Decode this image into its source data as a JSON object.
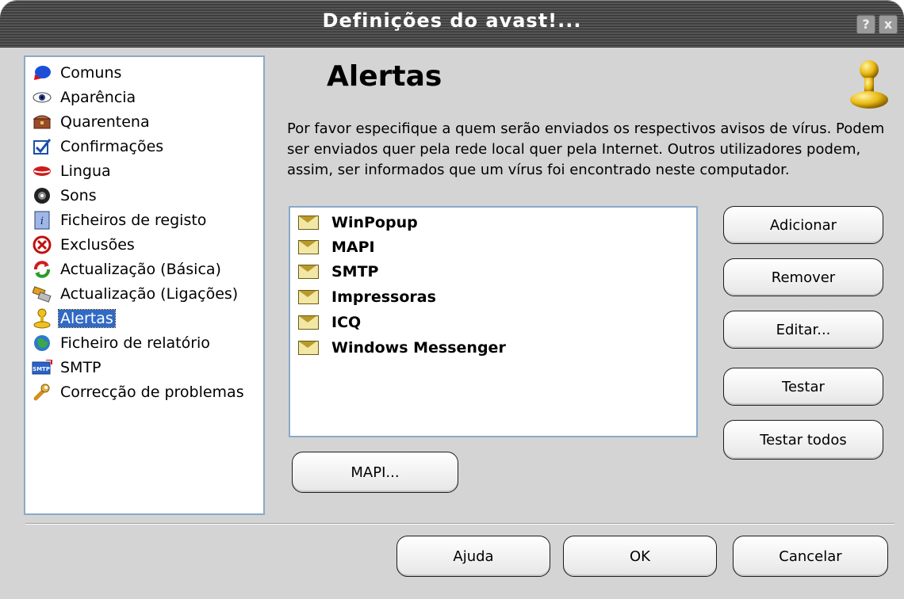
{
  "window": {
    "title": "Definições do avast!...",
    "help_btn": "?",
    "close_btn": "x"
  },
  "sidebar": {
    "items": [
      {
        "label": "Comuns",
        "icon": "cap-icon"
      },
      {
        "label": "Aparência",
        "icon": "eye-icon"
      },
      {
        "label": "Quarentena",
        "icon": "chest-icon"
      },
      {
        "label": "Confirmações",
        "icon": "checkbox-icon"
      },
      {
        "label": "Lingua",
        "icon": "lips-icon"
      },
      {
        "label": "Sons",
        "icon": "speaker-icon"
      },
      {
        "label": "Ficheiros de registo",
        "icon": "info-icon"
      },
      {
        "label": "Exclusões",
        "icon": "cross-circle-icon"
      },
      {
        "label": "Actualização (Básica)",
        "icon": "update-icon"
      },
      {
        "label": "Actualização (Ligações)",
        "icon": "connection-icon"
      },
      {
        "label": "Alertas",
        "icon": "alert-figure-icon",
        "selected": true
      },
      {
        "label": "Ficheiro de relatório",
        "icon": "report-icon"
      },
      {
        "label": "SMTP",
        "icon": "smtp-icon"
      },
      {
        "label": "Correcção de problemas",
        "icon": "wrench-icon"
      }
    ]
  },
  "main": {
    "heading": "Alertas",
    "description": "Por favor especifique a quem serão enviados os respectivos avisos de vírus. Podem ser enviados quer pela rede local quer pela Internet. Outros utilizadores podem, assim, ser informados que um vírus foi encontrado neste computador.",
    "alerts": [
      "WinPopup",
      "MAPI",
      "SMTP",
      "Impressoras",
      "ICQ",
      "Windows Messenger"
    ],
    "buttons": {
      "add": "Adicionar",
      "remove": "Remover",
      "edit": "Editar...",
      "test": "Testar",
      "test_all": "Testar todos",
      "mapi": "MAPI..."
    }
  },
  "footer": {
    "help": "Ajuda",
    "ok": "OK",
    "cancel": "Cancelar"
  }
}
